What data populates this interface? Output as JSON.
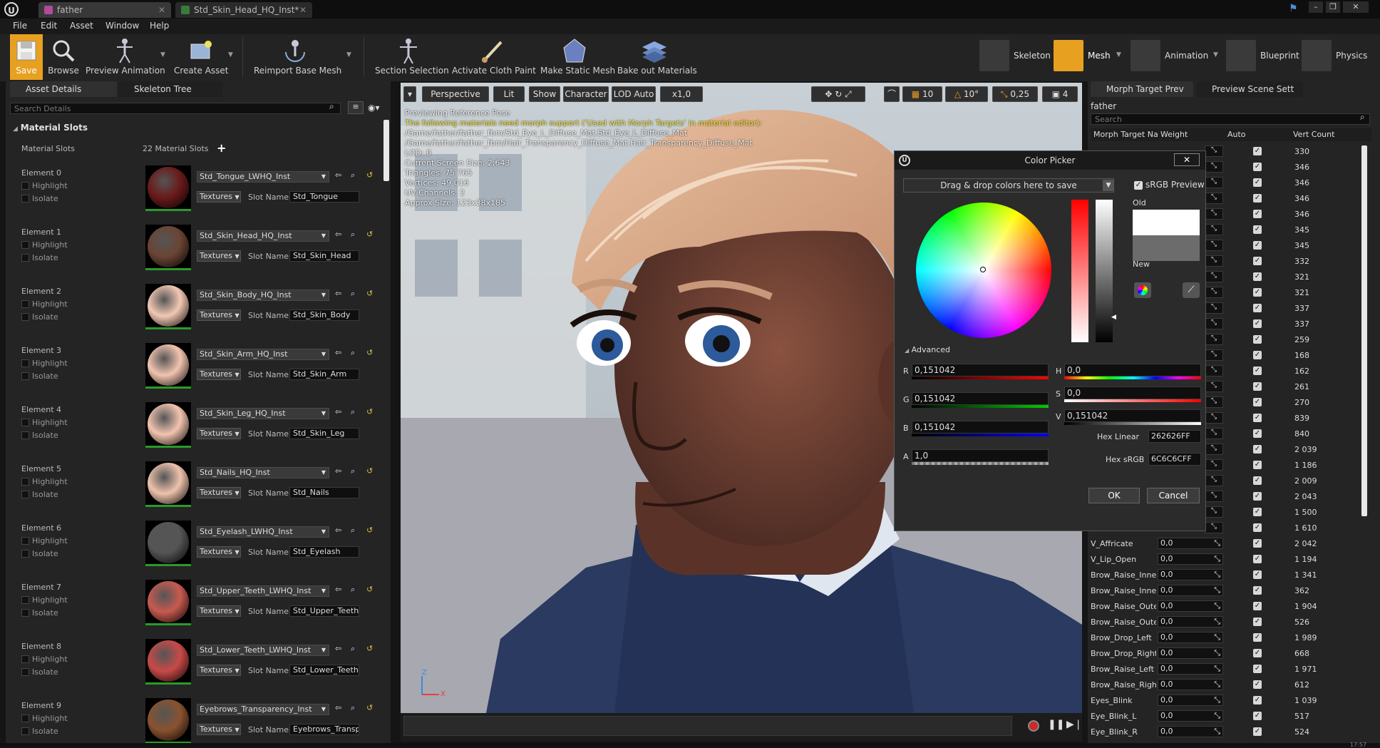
{
  "titlebar": {
    "tabs": [
      {
        "label": "father",
        "active": true
      },
      {
        "label": "Std_Skin_Head_HQ_Inst*",
        "active": false
      }
    ]
  },
  "menu": [
    "File",
    "Edit",
    "Asset",
    "Window",
    "Help"
  ],
  "toolbar": {
    "save": "Save",
    "browse": "Browse",
    "preview_animation": "Preview Animation",
    "create_asset": "Create Asset",
    "reimport": "Reimport Base Mesh",
    "section_selection": "Section Selection",
    "activate_cloth": "Activate Cloth Paint",
    "make_static": "Make Static Mesh",
    "bake_out": "Bake out Materials"
  },
  "modes": [
    "Skeleton",
    "Mesh",
    "Animation",
    "Blueprint",
    "Physics"
  ],
  "left_panel": {
    "tabs": [
      "Asset Details",
      "Skeleton Tree"
    ],
    "search_placeholder": "Search Details",
    "section": "Material Slots",
    "slots_label": "Material Slots",
    "slots_count": "22 Material Slots",
    "highlight": "Highlight",
    "isolate": "Isolate",
    "textures": "Textures",
    "slot_name_label": "Slot Name",
    "elements": [
      {
        "label": "Element 0",
        "material": "Std_Tongue_LWHQ_Inst",
        "slot": "Std_Tongue",
        "color": "#6a1a1a"
      },
      {
        "label": "Element 1",
        "material": "Std_Skin_Head_HQ_Inst",
        "slot": "Std_Skin_Head",
        "color": "#6a4434"
      },
      {
        "label": "Element 2",
        "material": "Std_Skin_Body_HQ_Inst",
        "slot": "Std_Skin_Body",
        "color": "#f2c8b4"
      },
      {
        "label": "Element 3",
        "material": "Std_Skin_Arm_HQ_Inst",
        "slot": "Std_Skin_Arm",
        "color": "#f2c4b0"
      },
      {
        "label": "Element 4",
        "material": "Std_Skin_Leg_HQ_Inst",
        "slot": "Std_Skin_Leg",
        "color": "#f2c4b0"
      },
      {
        "label": "Element 5",
        "material": "Std_Nails_HQ_Inst",
        "slot": "Std_Nails",
        "color": "#eec2ac"
      },
      {
        "label": "Element 6",
        "material": "Std_Eyelash_LWHQ_Inst",
        "slot": "Std_Eyelash",
        "color": "#555555"
      },
      {
        "label": "Element 7",
        "material": "Std_Upper_Teeth_LWHQ_Inst",
        "slot": "Std_Upper_Teeth",
        "color": "#c85a50"
      },
      {
        "label": "Element 8",
        "material": "Std_Lower_Teeth_LWHQ_Inst",
        "slot": "Std_Lower_Teeth",
        "color": "#c84a48"
      },
      {
        "label": "Element 9",
        "material": "Eyebrows_Transparency_Inst",
        "slot": "Eyebrows_Transpa",
        "color": "#8a5230"
      }
    ]
  },
  "viewport": {
    "buttons": [
      "Perspective",
      "Lit",
      "Show",
      "Character",
      "LOD Auto",
      "x1,0"
    ],
    "right_values": [
      "10",
      "10°",
      "0,25",
      "4"
    ],
    "info": [
      {
        "text": "Previewing Reference Pose",
        "warn": false
      },
      {
        "text": "The following materials need morph support ('Used with Morph Targets' in material editor):",
        "warn": true
      },
      {
        "text": "/Game/father/father_fbm/Std_Eye_L_Diffuse_Mat.Std_Eye_L_Diffuse_Mat",
        "warn": false
      },
      {
        "text": "/Game/father/father_fbm/Hair_Transparency_Diffuse_Mat.Hair_Transparency_Diffuse_Mat",
        "warn": false
      },
      {
        "text": "LOD: 0",
        "warn": false
      },
      {
        "text": "Current Screen Size: 2,643",
        "warn": false
      },
      {
        "text": "Triangles: 75 765",
        "warn": false
      },
      {
        "text": "Vertices: 49 016",
        "warn": false
      },
      {
        "text": "UV Channels: 2",
        "warn": false
      },
      {
        "text": "Approx Size: 123x38x185",
        "warn": false
      }
    ],
    "axis_z": "Z",
    "axis_x": "X"
  },
  "right_panel": {
    "tabs": [
      "Morph Target Prev",
      "Preview Scene Sett"
    ],
    "asset": "father",
    "search_placeholder": "Search",
    "columns": [
      "Morph Target Na",
      "Weight",
      "Auto",
      "Vert Count"
    ],
    "counts_top": [
      "330",
      "346",
      "346",
      "346",
      "346",
      "345",
      "345",
      "332",
      "321",
      "321",
      "337",
      "337",
      "259",
      "168",
      "162",
      "261",
      "270",
      "839",
      "840",
      "2 039",
      "1 186",
      "2 009",
      "2 043",
      "1 500",
      "1 610"
    ],
    "rows": [
      {
        "name": "V_Affricate",
        "weight": "0,0",
        "count": "2 042"
      },
      {
        "name": "V_Lip_Open",
        "weight": "0,0",
        "count": "1 194"
      },
      {
        "name": "Brow_Raise_Inner",
        "weight": "0,0",
        "count": "1 341"
      },
      {
        "name": "Brow_Raise_Inner",
        "weight": "0,0",
        "count": "362"
      },
      {
        "name": "Brow_Raise_Oute",
        "weight": "0,0",
        "count": "1 904"
      },
      {
        "name": "Brow_Raise_Oute",
        "weight": "0,0",
        "count": "526"
      },
      {
        "name": "Brow_Drop_Left",
        "weight": "0,0",
        "count": "1 989"
      },
      {
        "name": "Brow_Drop_Right",
        "weight": "0,0",
        "count": "668"
      },
      {
        "name": "Brow_Raise_Left",
        "weight": "0,0",
        "count": "1 971"
      },
      {
        "name": "Brow_Raise_Righ",
        "weight": "0,0",
        "count": "612"
      },
      {
        "name": "Eyes_Blink",
        "weight": "0,0",
        "count": "1 039"
      },
      {
        "name": "Eye_Blink_L",
        "weight": "0,0",
        "count": "517"
      },
      {
        "name": "Eye_Blink_R",
        "weight": "0,0",
        "count": "524"
      }
    ]
  },
  "color_picker": {
    "title": "Color Picker",
    "dropzone": "Drag & drop colors here to save",
    "srgb_preview": "sRGB Preview",
    "old_label": "Old",
    "new_label": "New",
    "old_color": "#ffffff",
    "new_color": "#6c6c6c",
    "advanced": "Advanced",
    "r_label": "R",
    "r": "0,151042",
    "g_label": "G",
    "g": "0,151042",
    "b_label": "B",
    "b": "0,151042",
    "a_label": "A",
    "a": "1,0",
    "h_label": "H",
    "h": "0,0",
    "s_label": "S",
    "s": "0,0",
    "v_label": "V",
    "v": "0,151042",
    "hex_linear_label": "Hex Linear",
    "hex_linear": "262626FF",
    "hex_srgb_label": "Hex sRGB",
    "hex_srgb": "6C6C6CFF",
    "ok": "OK",
    "cancel": "Cancel"
  },
  "status": {
    "time": "17:57"
  }
}
